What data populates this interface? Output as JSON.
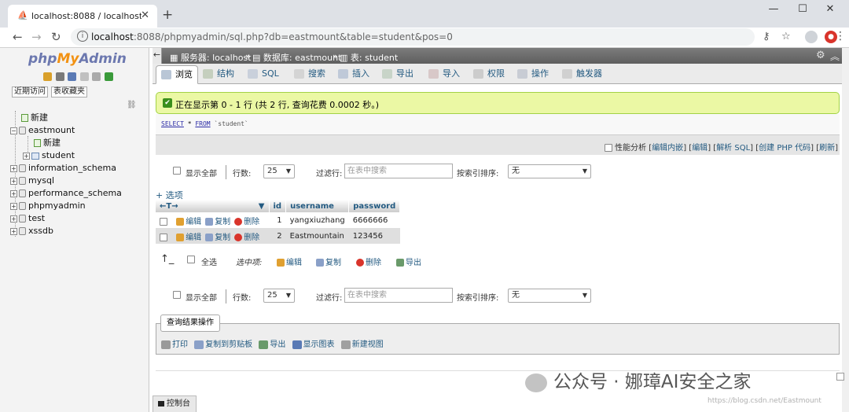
{
  "browser": {
    "tab_title": "localhost:8088 / localhost / ea",
    "tab_close": "✕",
    "new_tab": "+",
    "win_min": "—",
    "win_max": "☐",
    "win_close": "✕",
    "url_host": "localhost",
    "url_rest": ":8088/phpmyadmin/sql.php?db=eastmount&table=student&pos=0"
  },
  "nav": {
    "logo_php": "php",
    "logo_my": "My",
    "logo_admin": "Admin",
    "recent": "近期访问",
    "favorites": "表收藏夹",
    "tree": {
      "new_root": "新建",
      "db_eastmount": "eastmount",
      "new_table": "新建",
      "table_student": "student",
      "db_information_schema": "information_schema",
      "db_mysql": "mysql",
      "db_performance_schema": "performance_schema",
      "db_phpmyadmin": "phpmyadmin",
      "db_test": "test",
      "db_xssdb": "xssdb"
    }
  },
  "header": {
    "server": "服务器: localhost",
    "database": "数据库: eastmount",
    "table": "表: student",
    "sep": "»"
  },
  "tabs": [
    {
      "label": "浏览",
      "active": true
    },
    {
      "label": "结构"
    },
    {
      "label": "SQL"
    },
    {
      "label": "搜索"
    },
    {
      "label": "插入"
    },
    {
      "label": "导出"
    },
    {
      "label": "导入"
    },
    {
      "label": "权限"
    },
    {
      "label": "操作"
    },
    {
      "label": "触发器"
    }
  ],
  "result": {
    "success_msg": "正在显示第 0 - 1 行 (共 2 行, 查询花费 0.0002 秒。)",
    "sql_select": "SELECT",
    "sql_star": " * ",
    "sql_from": "FROM",
    "sql_table": " `student`"
  },
  "sql_links": {
    "profiling": "性能分析",
    "lb": "[",
    "rb": "]",
    "pipe": "|",
    "inline_edit": "编辑内嵌",
    "edit": "编辑",
    "explain": "解析 SQL",
    "create_php": "创建 PHP 代码",
    "refresh": "刷新"
  },
  "navigation": {
    "show_all": "显示全部",
    "rows_label": "行数:",
    "rows_value": "25",
    "filter_label": "过滤行:",
    "filter_placeholder": "在表中搜索",
    "sort_label": "按索引排序:",
    "sort_value": "无"
  },
  "table": {
    "options_link": "+ 选项",
    "sort_arrows": "←T→",
    "sort_icon": "▼",
    "columns": [
      "id",
      "username",
      "password"
    ],
    "actions": {
      "edit": "编辑",
      "copy": "复制",
      "delete": "删除"
    },
    "rows": [
      {
        "id": "1",
        "username": "yangxiuzhang",
        "password": "6666666"
      },
      {
        "id": "2",
        "username": "Eastmountain",
        "password": "123456"
      }
    ]
  },
  "bulk": {
    "check_all": "全选",
    "with_selected": "选中项:",
    "edit": "编辑",
    "copy": "复制",
    "delete": "删除",
    "export": "导出"
  },
  "query_ops": {
    "legend": "查询结果操作",
    "print": "打印",
    "copy_clipboard": "复制到剪贴板",
    "export": "导出",
    "show_chart": "显示图表",
    "create_view": "新建视图"
  },
  "console": "控制台",
  "watermark": {
    "text": "公众号 · 娜璋AI安全之家",
    "csdn": "https://blog.csdn.net/Eastmount"
  },
  "colors": {
    "link": "#235a81",
    "success_bg": "#ebf8a4",
    "logo_blue": "#6c78af",
    "logo_orange": "#f29111"
  }
}
